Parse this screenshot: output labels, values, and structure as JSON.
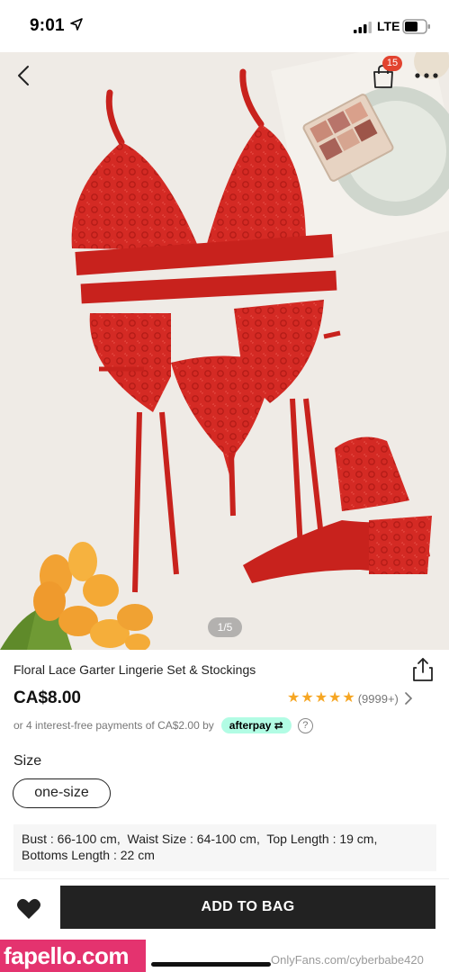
{
  "status_bar": {
    "time": "9:01",
    "network": "LTE"
  },
  "nav": {
    "back_icon": "chevron-left-icon",
    "bag_icon": "shopping-bag-icon",
    "bag_count": "15",
    "more_icon": "more-dots-icon"
  },
  "gallery": {
    "page_indicator": "1/5"
  },
  "product": {
    "title": "Floral Lace Garter Lingerie Set & Stockings",
    "price": "CA$8.00",
    "rating_stars": 5,
    "review_count": "(9999+)",
    "installments_text": "or 4 interest-free payments of CA$2.00 by",
    "afterpay_label": "afterpay",
    "help_label": "?"
  },
  "size": {
    "label": "Size",
    "selected": "one-size"
  },
  "measurements": {
    "bust_label": "Bust",
    "bust_value": ": 66-100 cm,",
    "waist_label": "Waist Size",
    "waist_value": ": 64-100 cm,",
    "top_label": "Top Length",
    "top_value": ": 19 cm,",
    "bottoms_label": "Bottoms Length",
    "bottoms_value": ": 22 cm"
  },
  "actions": {
    "add_to_bag": "ADD TO BAG",
    "wishlist_icon": "heart-icon"
  },
  "watermarks": {
    "left": "fapello.com",
    "right": "OnlyFans.com/cyberbabe420"
  },
  "colors": {
    "accent_button": "#222222",
    "badge": "#e2432f",
    "star": "#f6a623",
    "afterpay": "#b2fce4"
  }
}
